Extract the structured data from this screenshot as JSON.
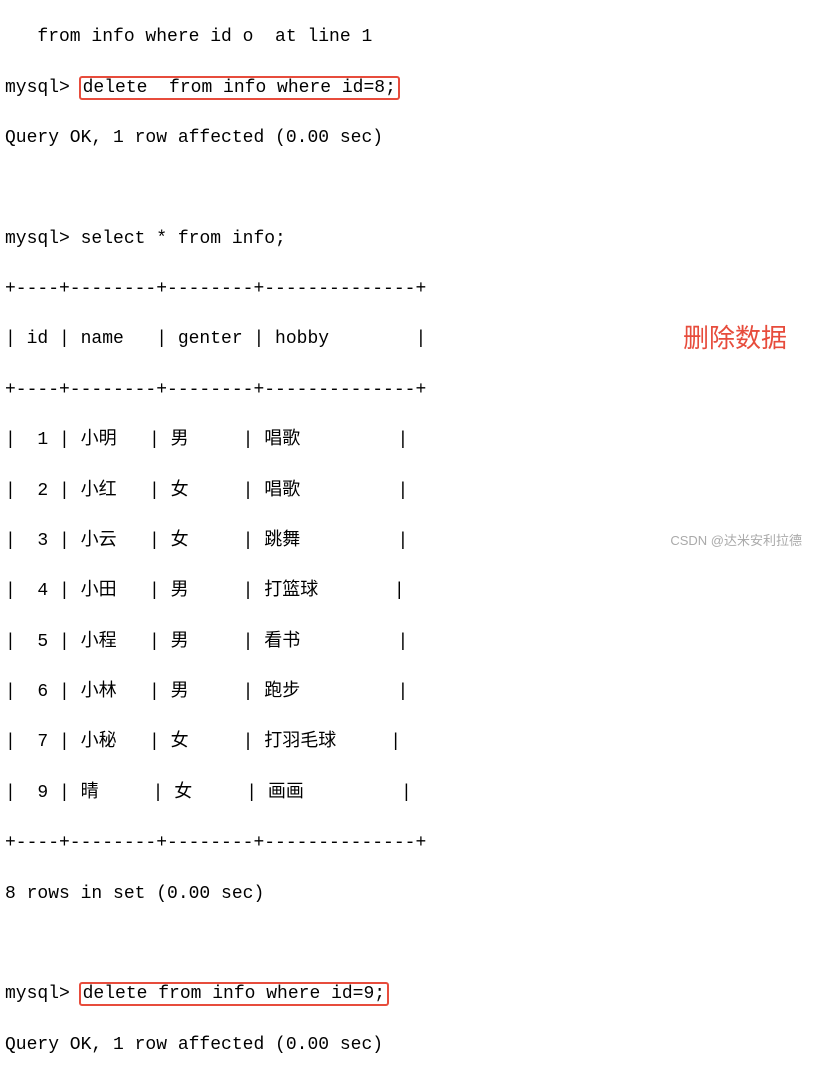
{
  "terminal": {
    "prompt": "mysql>",
    "line0_partial": "   from info where id o  at line 1",
    "cmd1": "delete  from info where id=8;",
    "result1": "Query OK, 1 row affected (0.00 sec)",
    "cmd2": "select * from info;",
    "cmd3": "delete from info where id=9;",
    "result3": "Query OK, 1 row affected (0.00 sec)"
  },
  "table": {
    "border_top": "+----+--------+--------+--------------+",
    "header": "| id | name   | genter | hobby        |",
    "border_mid": "+----+--------+--------+--------------+",
    "rows": [
      "|  1 | 小明   | 男     | 唱歌         |",
      "|  2 | 小红   | 女     | 唱歌         |",
      "|  3 | 小云   | 女     | 跳舞         |",
      "|  4 | 小田   | 男     | 打篮球       |",
      "|  5 | 小程   | 男     | 看书         |",
      "|  6 | 小林   | 男     | 跑步         |",
      "|  7 | 小秘   | 女     | 打羽毛球     |",
      "|  9 | 晴     | 女     | 画画         |"
    ],
    "border_bot": "+----+--------+--------+--------------+",
    "summary": "8 rows in set (0.00 sec)"
  },
  "chart_data": {
    "type": "table",
    "columns": [
      "id",
      "name",
      "genter",
      "hobby"
    ],
    "rows": [
      [
        1,
        "小明",
        "男",
        "唱歌"
      ],
      [
        2,
        "小红",
        "女",
        "唱歌"
      ],
      [
        3,
        "小云",
        "女",
        "跳舞"
      ],
      [
        4,
        "小田",
        "男",
        "打篮球"
      ],
      [
        5,
        "小程",
        "男",
        "看书"
      ],
      [
        6,
        "小林",
        "男",
        "跑步"
      ],
      [
        7,
        "小秘",
        "女",
        "打羽毛球"
      ],
      [
        9,
        "晴",
        "女",
        "画画"
      ]
    ]
  },
  "annotation": {
    "text": "删除数据"
  },
  "watermark": {
    "text": "CSDN @达米安利拉德"
  }
}
